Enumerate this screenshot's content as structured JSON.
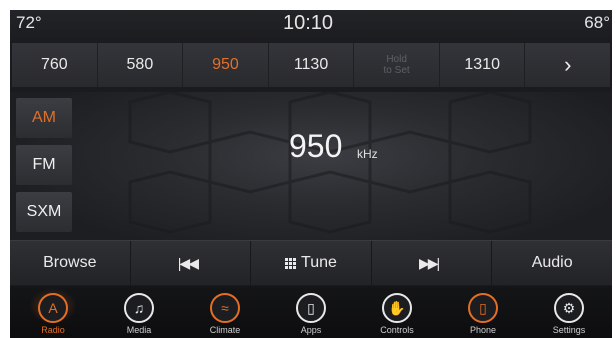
{
  "status": {
    "temp_left": "72°",
    "time": "10:10",
    "temp_right": "68°"
  },
  "presets": [
    {
      "label": "760",
      "active": false
    },
    {
      "label": "580",
      "active": false
    },
    {
      "label": "950",
      "active": true
    },
    {
      "label": "1130",
      "active": false
    },
    {
      "label_line1": "Hold",
      "label_line2": "to Set",
      "hold": true
    },
    {
      "label": "1310",
      "active": false
    }
  ],
  "next_icon": "chevron-right-icon",
  "bands": {
    "am": "AM",
    "fm": "FM",
    "sxm": "SXM",
    "active": "AM"
  },
  "tuner": {
    "frequency": "950",
    "unit": "kHz"
  },
  "controls": {
    "browse": "Browse",
    "seek_back_icon": "seek-back-icon",
    "tune": "Tune",
    "seek_forward_icon": "seek-forward-icon",
    "audio": "Audio"
  },
  "nav": [
    {
      "label": "Radio",
      "icon": "radio-icon",
      "active": true
    },
    {
      "label": "Media",
      "icon": "music-note-icon",
      "active": false
    },
    {
      "label": "Climate",
      "icon": "climate-icon",
      "active": false
    },
    {
      "label": "Apps",
      "icon": "apps-icon",
      "active": false
    },
    {
      "label": "Controls",
      "icon": "controls-icon",
      "active": false
    },
    {
      "label": "Phone",
      "icon": "phone-icon",
      "active": false
    },
    {
      "label": "Settings",
      "icon": "gear-icon",
      "active": false
    }
  ],
  "colors": {
    "accent": "#e46f24",
    "background": "#1a1b1e"
  }
}
